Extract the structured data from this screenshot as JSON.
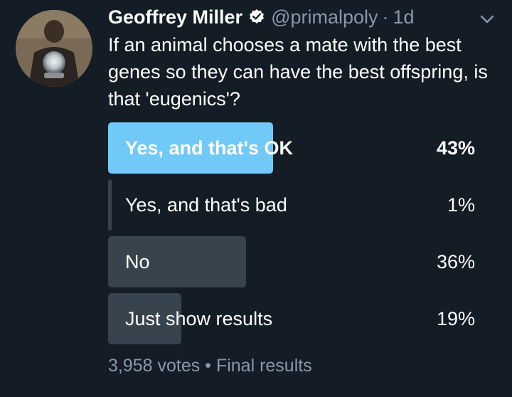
{
  "author": {
    "name": "Geoffrey Miller",
    "handle": "@primalpoly",
    "separator": "·",
    "time": "1d",
    "verified": true
  },
  "tweet": {
    "text": "If an animal chooses a mate with the best genes so they can have the best offspring, is that 'eugenics'?"
  },
  "poll": {
    "options": [
      {
        "label": "Yes, and that's OK",
        "percent_text": "43%",
        "percent": 43,
        "winner": true
      },
      {
        "label": "Yes, and that's bad",
        "percent_text": "1%",
        "percent": 1,
        "winner": false
      },
      {
        "label": "No",
        "percent_text": "36%",
        "percent": 36,
        "winner": false
      },
      {
        "label": "Just show results",
        "percent_text": "19%",
        "percent": 19,
        "winner": false
      }
    ],
    "votes": "3,958 votes",
    "dot": "•",
    "status": "Final results"
  },
  "colors": {
    "background": "#141d26",
    "winner_bar": "#71c9f8",
    "bar": "#38444d",
    "secondary_text": "#8899a6"
  },
  "icons": {
    "verified": "verified-badge-icon",
    "more": "chevron-down-icon"
  }
}
